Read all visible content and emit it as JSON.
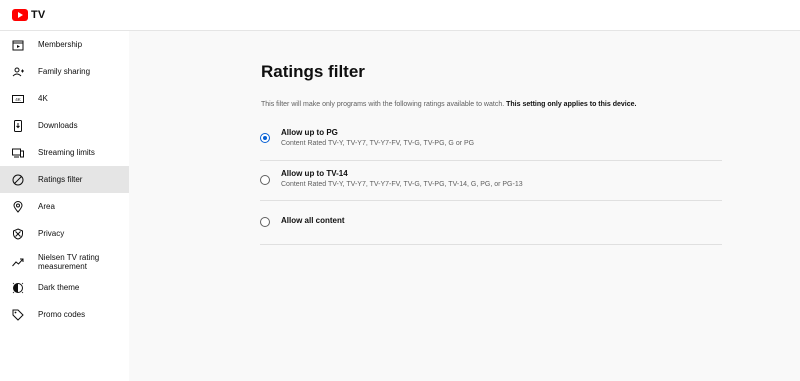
{
  "brand": {
    "logo_text": "TV"
  },
  "sidebar": {
    "items": [
      {
        "label": "Membership",
        "icon": "membership-icon"
      },
      {
        "label": "Family sharing",
        "icon": "family-icon"
      },
      {
        "label": "4K",
        "icon": "4k-icon"
      },
      {
        "label": "Downloads",
        "icon": "downloads-icon"
      },
      {
        "label": "Streaming limits",
        "icon": "devices-icon"
      },
      {
        "label": "Ratings filter",
        "icon": "ratings-filter-icon",
        "selected": true
      },
      {
        "label": "Area",
        "icon": "location-pin-icon"
      },
      {
        "label": "Privacy",
        "icon": "shield-icon"
      },
      {
        "label": "Nielsen TV rating measurement",
        "icon": "trend-icon"
      },
      {
        "label": "Dark theme",
        "icon": "dark-theme-icon"
      },
      {
        "label": "Promo codes",
        "icon": "tag-icon"
      }
    ]
  },
  "main": {
    "title": "Ratings filter",
    "description": "This filter will make only programs with the following ratings available to watch.",
    "description_bold": "This setting only applies to this device.",
    "options": [
      {
        "title": "Allow up to PG",
        "subtitle": "Content Rated TV-Y, TV-Y7, TV-Y7-FV, TV-G, TV-PG, G or PG",
        "checked": true
      },
      {
        "title": "Allow up to TV-14",
        "subtitle": "Content Rated TV-Y, TV-Y7, TV-Y7-FV, TV-G, TV-PG, TV-14, G, PG, or PG-13",
        "checked": false
      },
      {
        "title": "Allow all content",
        "subtitle": "",
        "checked": false
      }
    ]
  },
  "colors": {
    "accent": "#065fd4",
    "brand_red": "#ff0000",
    "selected_bg": "#e5e5e5",
    "main_bg": "#f9f9f9"
  }
}
